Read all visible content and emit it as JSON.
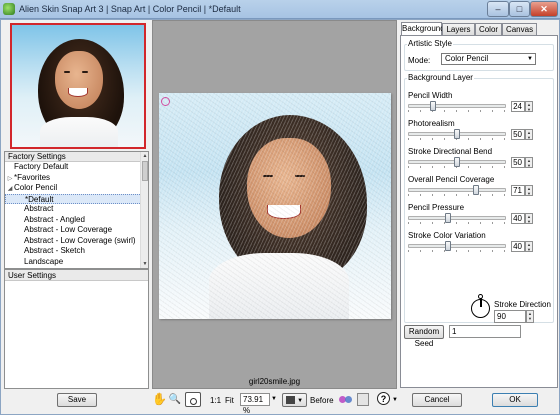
{
  "window": {
    "title": "Alien Skin Snap Art 3 | Snap Art | Color Pencil | *Default",
    "controls": {
      "minimize": "–",
      "maximize": "□",
      "close": "✕"
    }
  },
  "preset_tree": {
    "header": "Factory Settings",
    "items": [
      {
        "label": "Factory Default",
        "arrow": ""
      },
      {
        "label": "*Favorites",
        "arrow": "▷"
      },
      {
        "label": "Color Pencil",
        "arrow": "◢"
      },
      {
        "label": "*Default",
        "arrow": ""
      },
      {
        "label": "Abstract",
        "arrow": ""
      },
      {
        "label": "Abstract - Angled",
        "arrow": ""
      },
      {
        "label": "Abstract - Low Coverage",
        "arrow": ""
      },
      {
        "label": "Abstract - Low Coverage (swirl)",
        "arrow": ""
      },
      {
        "label": "Abstract - Sketch",
        "arrow": ""
      },
      {
        "label": "Landscape",
        "arrow": ""
      }
    ],
    "selected_index": 3
  },
  "user_settings": {
    "header": "User Settings"
  },
  "preview": {
    "filename": "girl20smile.jpg"
  },
  "bottom_bar": {
    "save_label": "Save",
    "zoom_1to1": "1:1",
    "fit_label": "Fit",
    "zoom_value": "73.91 %",
    "before_label": "Before",
    "cancel_label": "Cancel",
    "ok_label": "OK",
    "hand_icon": "✋",
    "zoom_icon": "🔍",
    "help_icon": "?"
  },
  "tabs": [
    "Background",
    "Layers",
    "Color",
    "Canvas"
  ],
  "active_tab": "Background",
  "artistic_style": {
    "group_label": "Artistic Style",
    "mode_label": "Mode:",
    "mode_value": "Color Pencil"
  },
  "background_layer": {
    "group_label": "Background Layer",
    "sliders": [
      {
        "label": "Pencil Width",
        "value": "24",
        "level": 0.24
      },
      {
        "label": "Photorealism",
        "value": "50",
        "level": 0.5
      },
      {
        "label": "Stroke Directional Bend",
        "value": "50",
        "level": 0.5
      },
      {
        "label": "Overall Pencil Coverage",
        "value": "71",
        "level": 0.71
      },
      {
        "label": "Pencil Pressure",
        "value": "40",
        "level": 0.4
      },
      {
        "label": "Stroke Color Variation",
        "value": "40",
        "level": 0.4
      }
    ],
    "stroke_direction_label": "Stroke Direction",
    "stroke_direction_value": "90"
  },
  "random_seed": {
    "label": "Random Seed",
    "value": "1"
  }
}
